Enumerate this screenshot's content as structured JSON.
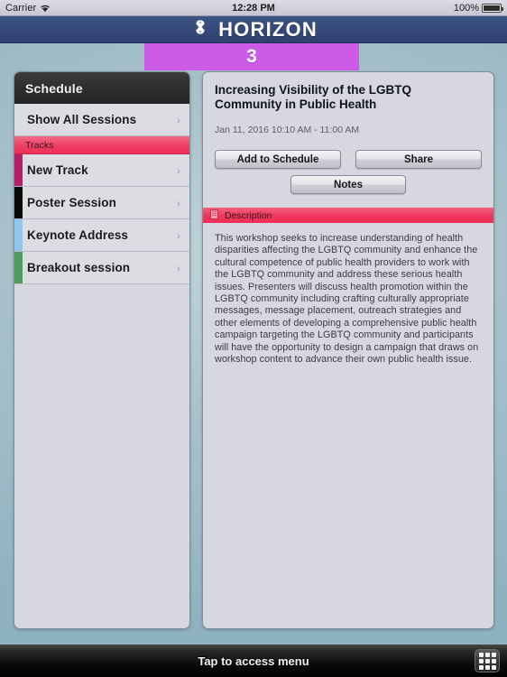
{
  "status_bar": {
    "carrier": "Carrier",
    "wifi_icon": "wifi-icon",
    "time": "12:28 PM",
    "battery_percent": "100%",
    "battery_icon": "battery-full-icon"
  },
  "title_bar": {
    "logo_icon": "horizon-loop-logo-icon",
    "app_title": "HORIZON"
  },
  "banner": {
    "number": "3",
    "color": "#ce5ae8"
  },
  "sidebar": {
    "header": "Schedule",
    "show_all": {
      "label": "Show All Sessions",
      "chevron": "›"
    },
    "tracks_header": "Tracks",
    "tracks": [
      {
        "label": "New Track",
        "color": "#b81e66",
        "chevron": "›"
      },
      {
        "label": "Poster Session",
        "color": "#0a0a0a",
        "chevron": "›"
      },
      {
        "label": "Keynote Address",
        "color": "#8ec8ef",
        "chevron": "›"
      },
      {
        "label": "Breakout session",
        "color": "#4f9b5c",
        "chevron": "›"
      }
    ]
  },
  "detail": {
    "session_title": "Increasing Visibility of the LGBTQ Community in Public Health",
    "session_date": "Jan 11, 2016 10:10 AM - 11:00 AM",
    "buttons": {
      "add_to_schedule": "Add to Schedule",
      "share": "Share",
      "notes": "Notes"
    },
    "description_section": {
      "icon": "note-document-icon",
      "label": "Description",
      "accent_color": "#ef2e56",
      "body": "This workshop seeks to increase understanding of health disparities affecting the LGBTQ community and enhance the cultural competence of public health providers to work with the LGBTQ community and address these serious health issues. Presenters will discuss health promotion within the LGBTQ community including crafting culturally appropriate messages, message placement, outreach strategies and other elements of developing a comprehensive public health campaign targeting the LGBTQ community and participants will have the opportunity to design a campaign that draws on workshop content to advance their own public health issue."
    }
  },
  "bottom_bar": {
    "label": "Tap to access menu",
    "grid_icon": "grid-menu-icon"
  }
}
